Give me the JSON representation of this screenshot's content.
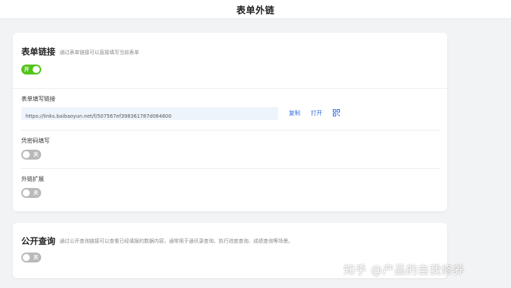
{
  "header": {
    "title": "表单外链"
  },
  "form_link": {
    "title": "表单链接",
    "description": "通过表单链接可以直接填写当前表单",
    "toggle": {
      "label": "开",
      "state": "on"
    },
    "fill_link": {
      "label": "表单填写链接",
      "url": "https://links.baibaoyun.net/f/507567ef398361787d064600",
      "copy_label": "复制",
      "open_label": "打开",
      "qr_icon": "qrcode-icon"
    },
    "password_fill": {
      "label": "凭密码填写",
      "toggle": {
        "label": "关",
        "state": "off"
      }
    },
    "link_extension": {
      "label": "外链扩展",
      "toggle": {
        "label": "关",
        "state": "off"
      }
    }
  },
  "public_query": {
    "title": "公开查询",
    "description": "通过公开查询链接可以查看已经填报的数据内容，通常用于通讯录查询、执行进度查询、成绩查询等场景。",
    "toggle": {
      "label": "关",
      "state": "off"
    }
  },
  "watermark": "知乎 @产品的自我修养",
  "colors": {
    "toggle_on": "#52c41a",
    "toggle_off": "#b9b9b9",
    "link": "#2f6bd8",
    "link_bg": "#eef4fc"
  }
}
